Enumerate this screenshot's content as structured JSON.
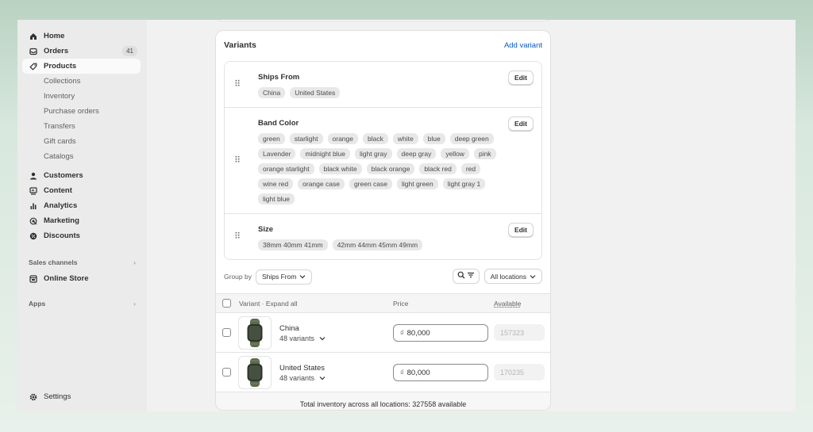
{
  "sidebar": {
    "home": "Home",
    "orders": "Orders",
    "orders_badge": "41",
    "products": "Products",
    "products_sub": [
      "Collections",
      "Inventory",
      "Purchase orders",
      "Transfers",
      "Gift cards",
      "Catalogs"
    ],
    "customers": "Customers",
    "content": "Content",
    "analytics": "Analytics",
    "marketing": "Marketing",
    "discounts": "Discounts",
    "sales_channels": "Sales channels",
    "online_store": "Online Store",
    "apps": "Apps",
    "settings": "Settings"
  },
  "variants": {
    "title": "Variants",
    "add_variant": "Add variant",
    "edit_label": "Edit",
    "options": [
      {
        "name": "Ships From",
        "values": [
          "China",
          "United States"
        ]
      },
      {
        "name": "Band Color",
        "values": [
          "green",
          "starlight",
          "orange",
          "black",
          "white",
          "blue",
          "deep green",
          "Lavender",
          "midnight blue",
          "light gray",
          "deep gray",
          "yellow",
          "pink",
          "orange starlight",
          "black white",
          "black orange",
          "black red",
          "red",
          "wine red",
          "orange case",
          "green case",
          "light green",
          "light gray 1",
          "light blue"
        ]
      },
      {
        "name": "Size",
        "values": [
          "38mm 40mm 41mm",
          "42mm 44mm 45mm 49mm"
        ]
      }
    ],
    "group_by_label": "Group by",
    "group_by_value": "Ships From",
    "locations_value": "All locations",
    "table": {
      "col_variant": "Variant · Expand all",
      "col_price": "Price",
      "col_available": "Available",
      "rows": [
        {
          "name": "China",
          "count": "48 variants",
          "currency": "₫",
          "price": "80,000",
          "available": "157323"
        },
        {
          "name": "United States",
          "count": "48 variants",
          "currency": "₫",
          "price": "80,000",
          "available": "170235"
        }
      ]
    },
    "footer": "Total inventory across all locations: 327558 available"
  }
}
